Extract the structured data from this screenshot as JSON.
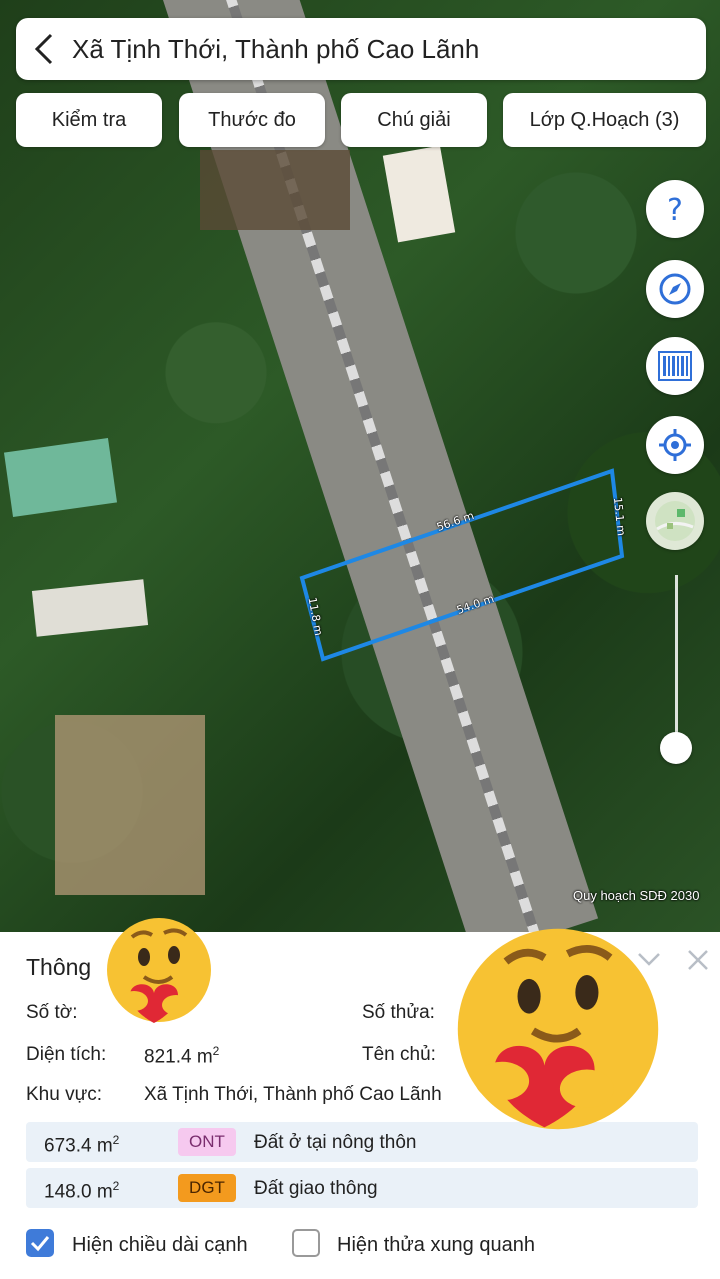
{
  "header": {
    "title": "Xã Tịnh Thới, Thành phố Cao Lãnh"
  },
  "toolbar": {
    "buttons": [
      "Kiểm tra",
      "Thước đo",
      "Chú giải",
      "Lớp Q.Hoạch (3)"
    ]
  },
  "map": {
    "edge_labels": [
      "56.6 m",
      "15.1 m",
      "54.0 m",
      "11.8 m"
    ],
    "watermark": "Quy hoạch SDĐ 2030",
    "parcel_color": "#1e88e5",
    "controls": [
      "help-icon",
      "compass-icon",
      "barcode-icon",
      "locate-icon",
      "map-thumbnail-icon"
    ]
  },
  "panel": {
    "title": "Thông",
    "labels": {
      "so_to": "Số tờ:",
      "so_thua": "Số thửa:",
      "dien_tich": "Diện tích:",
      "ten_chu": "Tên chủ:",
      "khu_vuc": "Khu vực:"
    },
    "dien_tich_value": "821.4",
    "unit": "m",
    "khu_vuc_value": "Xã Tịnh Thới, Thành phố Cao Lãnh",
    "land_use": [
      {
        "area": "673.4",
        "code": "ONT",
        "name": "Đất ở tại nông thôn",
        "code_bg": "#f6c9ef",
        "code_fg": "#7a2d6e"
      },
      {
        "area": "148.0",
        "code": "DGT",
        "name": "Đất giao thông",
        "code_bg": "#f39a1e",
        "code_fg": "#4a2500"
      }
    ],
    "checkboxes": [
      {
        "label": "Hiện chiều dài cạnh",
        "checked": true
      },
      {
        "label": "Hiện thửa xung quanh",
        "checked": false
      }
    ]
  },
  "colors": {
    "accent": "#2f6fd8"
  }
}
